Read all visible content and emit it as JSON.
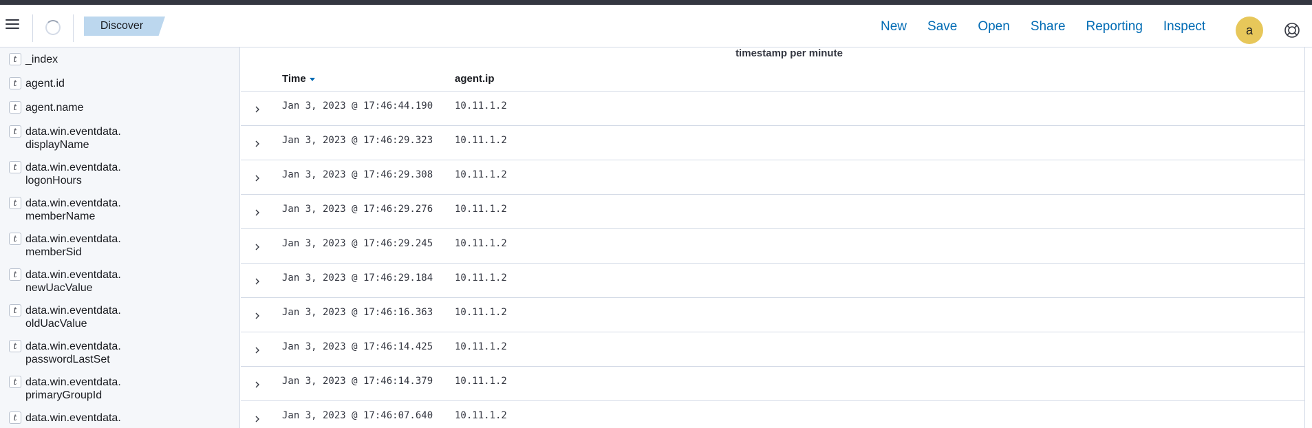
{
  "header": {
    "breadcrumb": "Discover",
    "nav": [
      "New",
      "Save",
      "Open",
      "Share",
      "Reporting",
      "Inspect"
    ],
    "avatar_initial": "a",
    "icons": {
      "menu": "hamburger-menu-icon",
      "loading": "loading-spinner-icon",
      "help": "help-lifebuoy-icon"
    }
  },
  "sidebar": {
    "fields": [
      {
        "type": "t",
        "name": "_index"
      },
      {
        "type": "t",
        "name": "agent.id"
      },
      {
        "type": "t",
        "name": "agent.name"
      },
      {
        "type": "t",
        "name": "data.win.eventdata.\ndisplayName"
      },
      {
        "type": "t",
        "name": "data.win.eventdata.\nlogonHours"
      },
      {
        "type": "t",
        "name": "data.win.eventdata.\nmemberName"
      },
      {
        "type": "t",
        "name": "data.win.eventdata.\nmemberSid"
      },
      {
        "type": "t",
        "name": "data.win.eventdata.\nnewUacValue"
      },
      {
        "type": "t",
        "name": "data.win.eventdata.\noldUacValue"
      },
      {
        "type": "t",
        "name": "data.win.eventdata.\npasswordLastSet"
      },
      {
        "type": "t",
        "name": "data.win.eventdata.\nprimaryGroupId"
      },
      {
        "type": "t",
        "name": "data.win.eventdata."
      }
    ]
  },
  "main": {
    "chart_title": "timestamp per minute",
    "columns": {
      "time": "Time",
      "ip": "agent.ip"
    },
    "rows": [
      {
        "time": "Jan 3, 2023 @ 17:46:44.190",
        "ip": "10.11.1.2"
      },
      {
        "time": "Jan 3, 2023 @ 17:46:29.323",
        "ip": "10.11.1.2"
      },
      {
        "time": "Jan 3, 2023 @ 17:46:29.308",
        "ip": "10.11.1.2"
      },
      {
        "time": "Jan 3, 2023 @ 17:46:29.276",
        "ip": "10.11.1.2"
      },
      {
        "time": "Jan 3, 2023 @ 17:46:29.245",
        "ip": "10.11.1.2"
      },
      {
        "time": "Jan 3, 2023 @ 17:46:29.184",
        "ip": "10.11.1.2"
      },
      {
        "time": "Jan 3, 2023 @ 17:46:16.363",
        "ip": "10.11.1.2"
      },
      {
        "time": "Jan 3, 2023 @ 17:46:14.425",
        "ip": "10.11.1.2"
      },
      {
        "time": "Jan 3, 2023 @ 17:46:14.379",
        "ip": "10.11.1.2"
      },
      {
        "time": "Jan 3, 2023 @ 17:46:07.640",
        "ip": "10.11.1.2"
      }
    ]
  },
  "colors": {
    "link": "#006bb4",
    "breadcrumb_bg": "#bcd7ee",
    "avatar_bg": "#e7c75a",
    "sidebar_bg": "#f5f7fa"
  }
}
